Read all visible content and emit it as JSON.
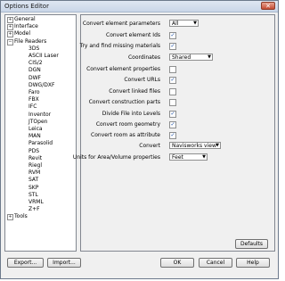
{
  "window": {
    "title": "Options Editor",
    "close_label": "✕"
  },
  "tree": {
    "collapsed_sign": "+",
    "expanded_sign": "−",
    "top_items": [
      {
        "label": "General"
      },
      {
        "label": "Interface"
      },
      {
        "label": "Model"
      }
    ],
    "file_readers": {
      "label": "File Readers",
      "children": [
        "3DS",
        "ASCII Laser",
        "CIS/2",
        "DGN",
        "DWF",
        "DWG/DXF",
        "Faro",
        "FBX",
        "IFC",
        "Inventor",
        "JTOpen",
        "Leica",
        "MAN",
        "Parasolid",
        "PDS",
        "Revit",
        "Riegl",
        "RVM",
        "SAT",
        "SKP",
        "STL",
        "VRML",
        "Z+F"
      ]
    },
    "bottom_items": [
      {
        "label": "Tools"
      }
    ]
  },
  "settings": [
    {
      "label": "Convert element parameters",
      "type": "dropdown",
      "value": "All"
    },
    {
      "label": "Convert element Ids",
      "type": "checkbox",
      "checked": true
    },
    {
      "label": "Try and find missing materials",
      "type": "checkbox",
      "checked": true
    },
    {
      "label": "Coordinates",
      "type": "dropdown",
      "value": "Shared"
    },
    {
      "label": "Convert element properties",
      "type": "checkbox",
      "checked": false
    },
    {
      "label": "Convert URLs",
      "type": "checkbox",
      "checked": true
    },
    {
      "label": "Convert linked files",
      "type": "checkbox",
      "checked": false
    },
    {
      "label": "Convert construction parts",
      "type": "checkbox",
      "checked": false
    },
    {
      "label": "Divide File into Levels",
      "type": "checkbox",
      "checked": true
    },
    {
      "label": "Convert room geometry",
      "type": "checkbox",
      "checked": true
    },
    {
      "label": "Convert room as attribute",
      "type": "checkbox",
      "checked": true
    },
    {
      "label": "Convert",
      "type": "dropdown",
      "value": "Navisworks view"
    },
    {
      "label": "Units for Area/Volume properties",
      "type": "dropdown",
      "value": "Feet"
    }
  ],
  "check_glyph": "✓",
  "dropdown_arrow": "▼",
  "buttons": {
    "defaults": "Defaults",
    "export": "Export...",
    "import": "Import...",
    "ok": "OK",
    "cancel": "Cancel",
    "help": "Help"
  }
}
